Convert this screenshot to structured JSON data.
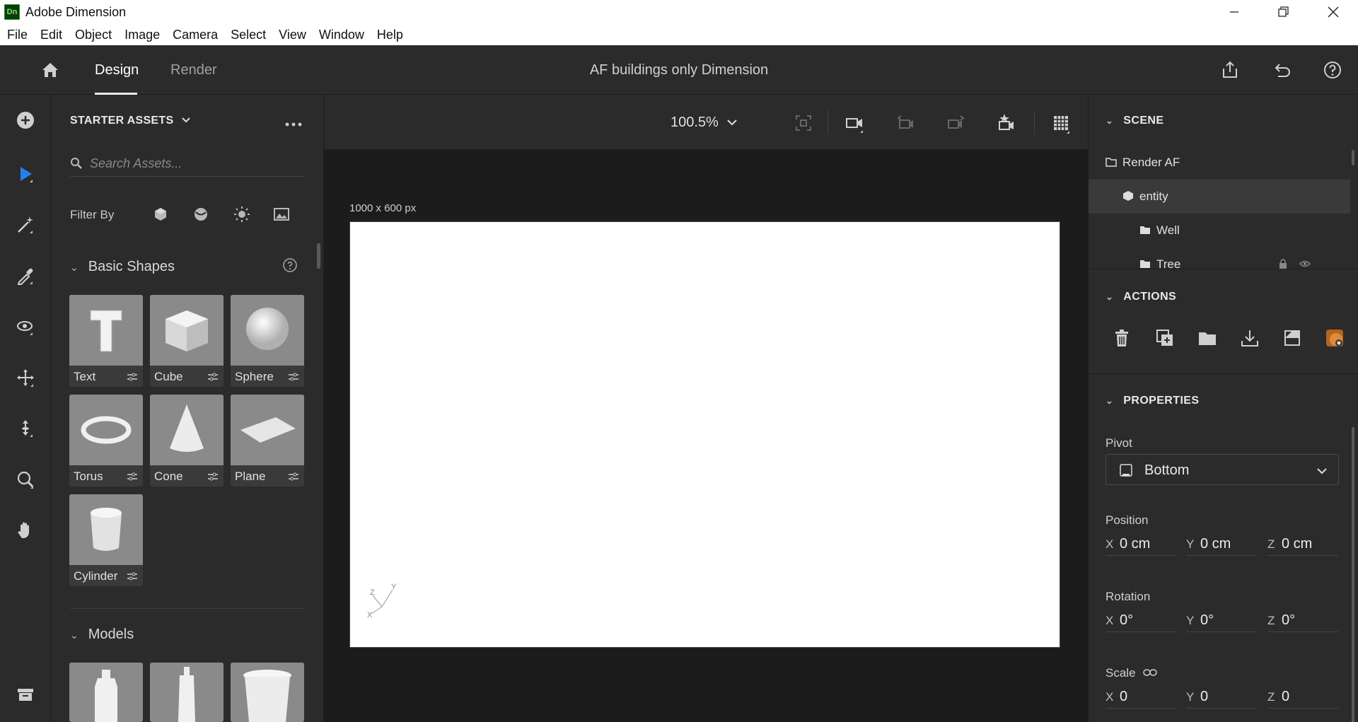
{
  "window": {
    "app_logo": "Dn",
    "title": "Adobe Dimension",
    "controls": [
      "minimize-icon",
      "restore-icon",
      "close-icon"
    ]
  },
  "menu": [
    "File",
    "Edit",
    "Object",
    "Image",
    "Camera",
    "Select",
    "View",
    "Window",
    "Help"
  ],
  "header": {
    "tabs": [
      {
        "label": "Design",
        "active": true
      },
      {
        "label": "Render",
        "active": false
      }
    ],
    "document_title": "AF buildings only Dimension",
    "right_icons": [
      "share-icon",
      "undo-icon",
      "help-icon"
    ]
  },
  "tools": [
    "add-icon",
    "select-icon",
    "magic-wand-icon",
    "eyedropper-icon",
    "orbit-icon",
    "pan-icon",
    "dolly-icon",
    "zoom-icon",
    "hand-icon",
    "library-icon"
  ],
  "assets": {
    "header": "STARTER ASSETS",
    "search_placeholder": "Search Assets...",
    "filter_label": "Filter By",
    "filter_icons": [
      "model-filter-icon",
      "material-filter-icon",
      "light-filter-icon",
      "image-filter-icon"
    ],
    "sections": [
      {
        "title": "Basic Shapes",
        "items": [
          "Text",
          "Cube",
          "Sphere",
          "Torus",
          "Cone",
          "Plane",
          "Cylinder"
        ]
      },
      {
        "title": "Models",
        "items": [
          "",
          "",
          ""
        ]
      }
    ]
  },
  "viewport": {
    "zoom": "100.5%",
    "canvas_size": "1000 x 600 px",
    "toolbar_icons": [
      "frame-selection-icon",
      "camera-view-icon",
      "camera-prev-icon",
      "camera-next-icon",
      "camera-bookmark-icon",
      "snap-grid-icon"
    ],
    "axes": {
      "x": "X",
      "y": "Y",
      "z": "Z"
    }
  },
  "scene": {
    "header": "SCENE",
    "items": [
      {
        "label": "Render AF",
        "icon": "folder-icon"
      },
      {
        "label": "entity",
        "icon": "model-icon",
        "selected": true
      },
      {
        "label": "Well",
        "icon": "folder-icon"
      },
      {
        "label": "Tree",
        "icon": "folder-icon"
      }
    ]
  },
  "actions": {
    "header": "ACTIONS",
    "icons": [
      "delete-icon",
      "duplicate-icon",
      "group-icon",
      "download-icon",
      "move-to-ground-icon",
      "material-icon"
    ]
  },
  "properties": {
    "header": "PROPERTIES",
    "pivot_label": "Pivot",
    "pivot_value": "Bottom",
    "position_label": "Position",
    "position": {
      "x": "0 cm",
      "y": "0 cm",
      "z": "0 cm"
    },
    "rotation_label": "Rotation",
    "rotation": {
      "x": "0°",
      "y": "0°",
      "z": "0°"
    },
    "scale_label": "Scale",
    "scale": {
      "x": "0",
      "y": "0",
      "z": "0"
    }
  },
  "colors": {
    "accent": "#2680eb",
    "panel": "#2b2b2b",
    "canvas_bg": "#1c1c1c",
    "artboard": "#ffffff"
  }
}
